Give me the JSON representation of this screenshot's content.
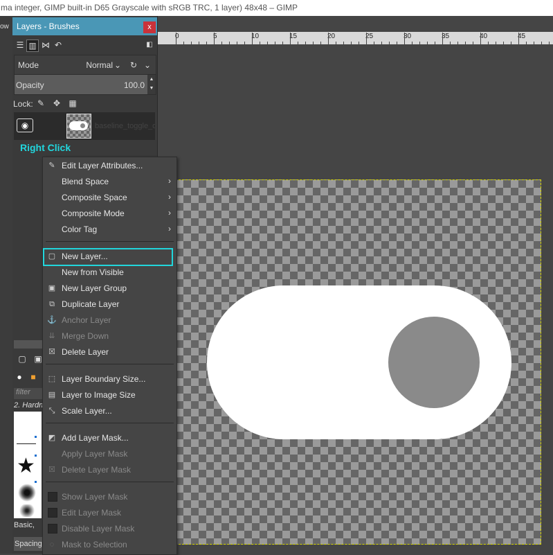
{
  "window": {
    "title": "ma integer, GIMP built-in D65 Grayscale with sRGB TRC, 1 layer) 48x48 – GIMP",
    "left_edge_label": "ow"
  },
  "ruler": {
    "labels": [
      "0",
      "5",
      "10",
      "15",
      "20",
      "25",
      "30",
      "35",
      "40",
      "45"
    ]
  },
  "dock": {
    "title": "Layers - Brushes",
    "close_label": "x",
    "mode_label": "Mode",
    "mode_value": "Normal",
    "opacity_label": "Opacity",
    "opacity_value": "100.0",
    "lock_label": "Lock:",
    "layer_name": "baseline_toggle_o",
    "annotation": "Right Click"
  },
  "brushes": {
    "filter_placeholder": "filter",
    "selected_brush": "2. Hardn",
    "preset_label": "Basic,",
    "spacing_label": "Spacing"
  },
  "context_menu": {
    "items": [
      {
        "label": "Edit Layer Attributes...",
        "icon": "edit-attributes-icon",
        "enabled": true,
        "submenu": false
      },
      {
        "label": "Blend Space",
        "icon": "",
        "enabled": true,
        "submenu": true
      },
      {
        "label": "Composite Space",
        "icon": "",
        "enabled": true,
        "submenu": true
      },
      {
        "label": "Composite Mode",
        "icon": "",
        "enabled": true,
        "submenu": true
      },
      {
        "label": "Color Tag",
        "icon": "",
        "enabled": true,
        "submenu": true
      },
      {
        "label": "New Layer...",
        "icon": "new-layer-icon",
        "enabled": true,
        "submenu": false,
        "highlighted": true
      },
      {
        "label": "New from Visible",
        "icon": "",
        "enabled": true,
        "submenu": false
      },
      {
        "label": "New Layer Group",
        "icon": "new-layer-group-icon",
        "enabled": true,
        "submenu": false
      },
      {
        "label": "Duplicate Layer",
        "icon": "duplicate-layer-icon",
        "enabled": true,
        "submenu": false
      },
      {
        "label": "Anchor Layer",
        "icon": "anchor-icon",
        "enabled": false,
        "submenu": false
      },
      {
        "label": "Merge Down",
        "icon": "merge-down-icon",
        "enabled": false,
        "submenu": false
      },
      {
        "label": "Delete Layer",
        "icon": "delete-icon",
        "enabled": true,
        "submenu": false
      },
      {
        "label": "Layer Boundary Size...",
        "icon": "boundary-size-icon",
        "enabled": true,
        "submenu": false
      },
      {
        "label": "Layer to Image Size",
        "icon": "layer-to-image-size-icon",
        "enabled": true,
        "submenu": false
      },
      {
        "label": "Scale Layer...",
        "icon": "scale-layer-icon",
        "enabled": true,
        "submenu": false
      },
      {
        "label": "Add Layer Mask...",
        "icon": "add-layer-mask-icon",
        "enabled": true,
        "submenu": false
      },
      {
        "label": "Apply Layer Mask",
        "icon": "",
        "enabled": false,
        "submenu": false
      },
      {
        "label": "Delete Layer Mask",
        "icon": "delete-mask-icon",
        "enabled": false,
        "submenu": false
      },
      {
        "label": "Show Layer Mask",
        "icon": "checkbox",
        "enabled": false,
        "submenu": false
      },
      {
        "label": "Edit Layer Mask",
        "icon": "checkbox",
        "enabled": false,
        "submenu": false
      },
      {
        "label": "Disable Layer Mask",
        "icon": "checkbox",
        "enabled": false,
        "submenu": false
      },
      {
        "label": "Mask to Selection",
        "icon": "mask-to-selection-icon",
        "enabled": false,
        "submenu": false
      }
    ]
  },
  "colors": {
    "accent": "#21d6dc",
    "dock_title": "#4a97b6",
    "close_button": "#c9323a",
    "canvas_border": "#d8d800"
  }
}
